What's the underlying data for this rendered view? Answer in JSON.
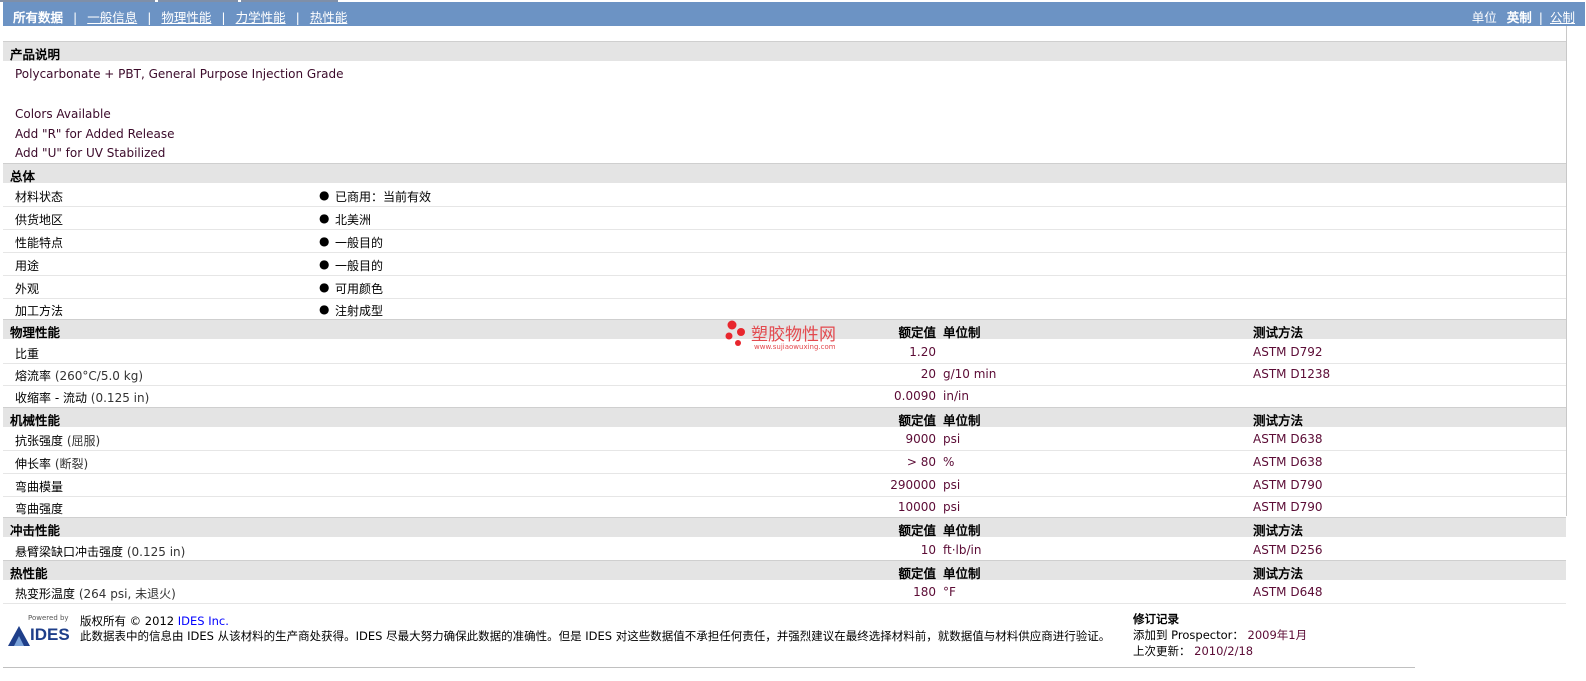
{
  "nav": {
    "tabs": [
      "所有数据",
      "一般信息",
      "物理性能",
      "力学性能",
      "热性能"
    ],
    "units_label": "单位",
    "unit_english": "英制",
    "unit_metric": "公制"
  },
  "product": {
    "title": "产品说明",
    "lines": [
      "Polycarbonate + PBT, General Purpose Injection Grade",
      "Colors Available",
      "Add \"R\" for Added Release",
      "Add \"U\" for UV Stabilized"
    ]
  },
  "general": {
    "title": "总体",
    "rows": [
      {
        "label": "材料状态",
        "value": "已商用：当前有效"
      },
      {
        "label": "供货地区",
        "value": "北美洲"
      },
      {
        "label": "性能特点",
        "value": "一般目的"
      },
      {
        "label": "用途",
        "value": "一般目的"
      },
      {
        "label": "外观",
        "value": "可用颜色"
      },
      {
        "label": "加工方法",
        "value": "注射成型"
      }
    ]
  },
  "headers": {
    "nominal": "额定值",
    "unit": "单位制",
    "test": "测试方法"
  },
  "physical": {
    "title": "物理性能",
    "rows": [
      {
        "label": "比重",
        "cond": "",
        "value": "1.20",
        "unit": "",
        "test": "ASTM D792"
      },
      {
        "label": "熔流率",
        "cond": "(260°C/5.0 kg)",
        "value": "20",
        "unit": "g/10 min",
        "test": "ASTM D1238"
      },
      {
        "label": "收缩率 - 流动",
        "cond": "(0.125 in)",
        "value": "0.0090",
        "unit": "in/in",
        "test": ""
      }
    ]
  },
  "mechanical": {
    "title": "机械性能",
    "rows": [
      {
        "label": "抗张强度",
        "cond": "(屈服)",
        "value": "9000",
        "unit": "psi",
        "test": "ASTM D638"
      },
      {
        "label": "伸长率",
        "cond": "(断裂)",
        "value": "> 80",
        "unit": "%",
        "test": "ASTM D638"
      },
      {
        "label": "弯曲模量",
        "cond": "",
        "value": "290000",
        "unit": "psi",
        "test": "ASTM D790"
      },
      {
        "label": "弯曲强度",
        "cond": "",
        "value": "10000",
        "unit": "psi",
        "test": "ASTM D790"
      }
    ]
  },
  "impact": {
    "title": "冲击性能",
    "rows": [
      {
        "label": "悬臂梁缺口冲击强度",
        "cond": "(0.125 in)",
        "value": "10",
        "unit": "ft·lb/in",
        "test": "ASTM D256"
      }
    ]
  },
  "thermal": {
    "title": "热性能",
    "rows": [
      {
        "label": "热变形温度",
        "cond": "(264 psi, 未退火)",
        "value": "180",
        "unit": "°F",
        "test": "ASTM D648"
      }
    ]
  },
  "footer": {
    "logo_small": "Powered by",
    "logo_text": "IDES",
    "copyright_prefix": "版权所有 © 2012 ",
    "copyright_link": "IDES Inc.",
    "disclaimer": "此数据表中的信息由 IDES 从该材料的生产商处获得。IDES 尽最大努力确保此数据的准确性。但是 IDES 对这些数据值不承担任何责任，并强烈建议在最终选择材料前，就数据值与材料供应商进行验证。",
    "revision_title": "修订记录",
    "added_label": "添加到 Prospector：",
    "added_value": "2009年1月",
    "updated_label": "上次更新：",
    "updated_value": "2010/2/18"
  },
  "watermark": {
    "title": "塑胶物性网",
    "url": "www.sujiaowuxing.com"
  },
  "colors": {
    "nav_bg": "#6c93c4",
    "section_bg": "#e4e4e4",
    "value_text": "#5b0b35",
    "watermark": "#e34a4f"
  }
}
